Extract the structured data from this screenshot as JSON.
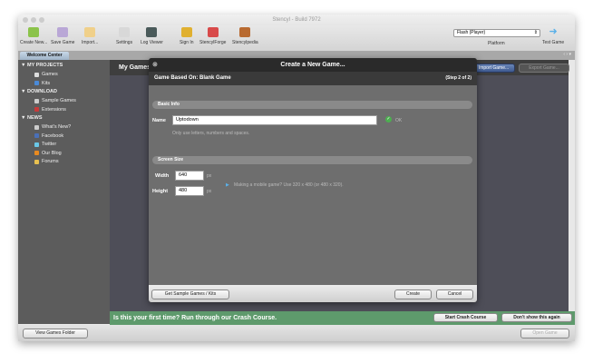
{
  "window": {
    "title": "Stencyl - Build 7972"
  },
  "toolbar": {
    "items": [
      {
        "label": "Create New...",
        "icon": "create-new-icon",
        "color": "#8bc34a"
      },
      {
        "label": "Save Game",
        "icon": "save-icon",
        "color": "#b9a7d6"
      },
      {
        "label": "Import...",
        "icon": "import-icon",
        "color": "#f0d08a"
      },
      {
        "label": "Settings",
        "icon": "settings-icon",
        "color": "#d8d8d8"
      },
      {
        "label": "Log Viewer",
        "icon": "log-viewer-icon",
        "color": "#4a5a5a"
      },
      {
        "label": "Sign In",
        "icon": "key-icon",
        "color": "#e0b030"
      },
      {
        "label": "StencylForge",
        "icon": "store-icon",
        "color": "#d84a4a"
      },
      {
        "label": "Stencylpedia",
        "icon": "book-icon",
        "color": "#b86a30"
      }
    ],
    "platform_label": "Platform",
    "platform_value": "Flash (Player)",
    "test_game": "Test Game"
  },
  "tabs": [
    {
      "label": "Welcome Center"
    }
  ],
  "sidebar": {
    "sections": [
      {
        "label": "MY PROJECTS",
        "items": [
          {
            "label": "Games",
            "color": "#ddd"
          },
          {
            "label": "Kits",
            "color": "#4a8ad8"
          }
        ]
      },
      {
        "label": "DOWNLOAD",
        "items": [
          {
            "label": "Sample Games",
            "color": "#ccc"
          },
          {
            "label": "Extensions",
            "color": "#c83a3a"
          }
        ]
      },
      {
        "label": "NEWS",
        "items": [
          {
            "label": "What's New?",
            "color": "#ccc"
          },
          {
            "label": "Facebook",
            "color": "#4a70b8"
          },
          {
            "label": "Twitter",
            "color": "#6ac8e8"
          },
          {
            "label": "Our Blog",
            "color": "#e88a20"
          },
          {
            "label": "Forums",
            "color": "#e8c050"
          }
        ]
      }
    ]
  },
  "main": {
    "header": "My Games",
    "import_game": "Import Game...",
    "export_game": "Export Game..."
  },
  "dialog": {
    "title": "Create a New Game...",
    "subtitle": "Game Based On: Blank Game",
    "step": "(Step 2 of 2)",
    "basic_info": "Basic Info",
    "name_label": "Name",
    "name_value": "Uptodown",
    "ok": "OK",
    "name_hint": "Only use letters, numbers and spaces.",
    "screen_size": "Screen Size",
    "width_label": "Width",
    "width_value": "640",
    "height_label": "Height",
    "height_value": "480",
    "unit": "px",
    "mobile_hint": "Making a mobile game? Use 320 x 480 (or 480 x 320).",
    "get_samples": "Get Sample Games / Kits",
    "create": "Create",
    "cancel": "Cancel"
  },
  "banner": {
    "text": "Is this your first time? Run through our Crash Course.",
    "start": "Start Crash Course",
    "dismiss": "Don't show this again"
  },
  "bottom": {
    "view_folder": "View Games Folder",
    "open_game": "Open Game"
  }
}
